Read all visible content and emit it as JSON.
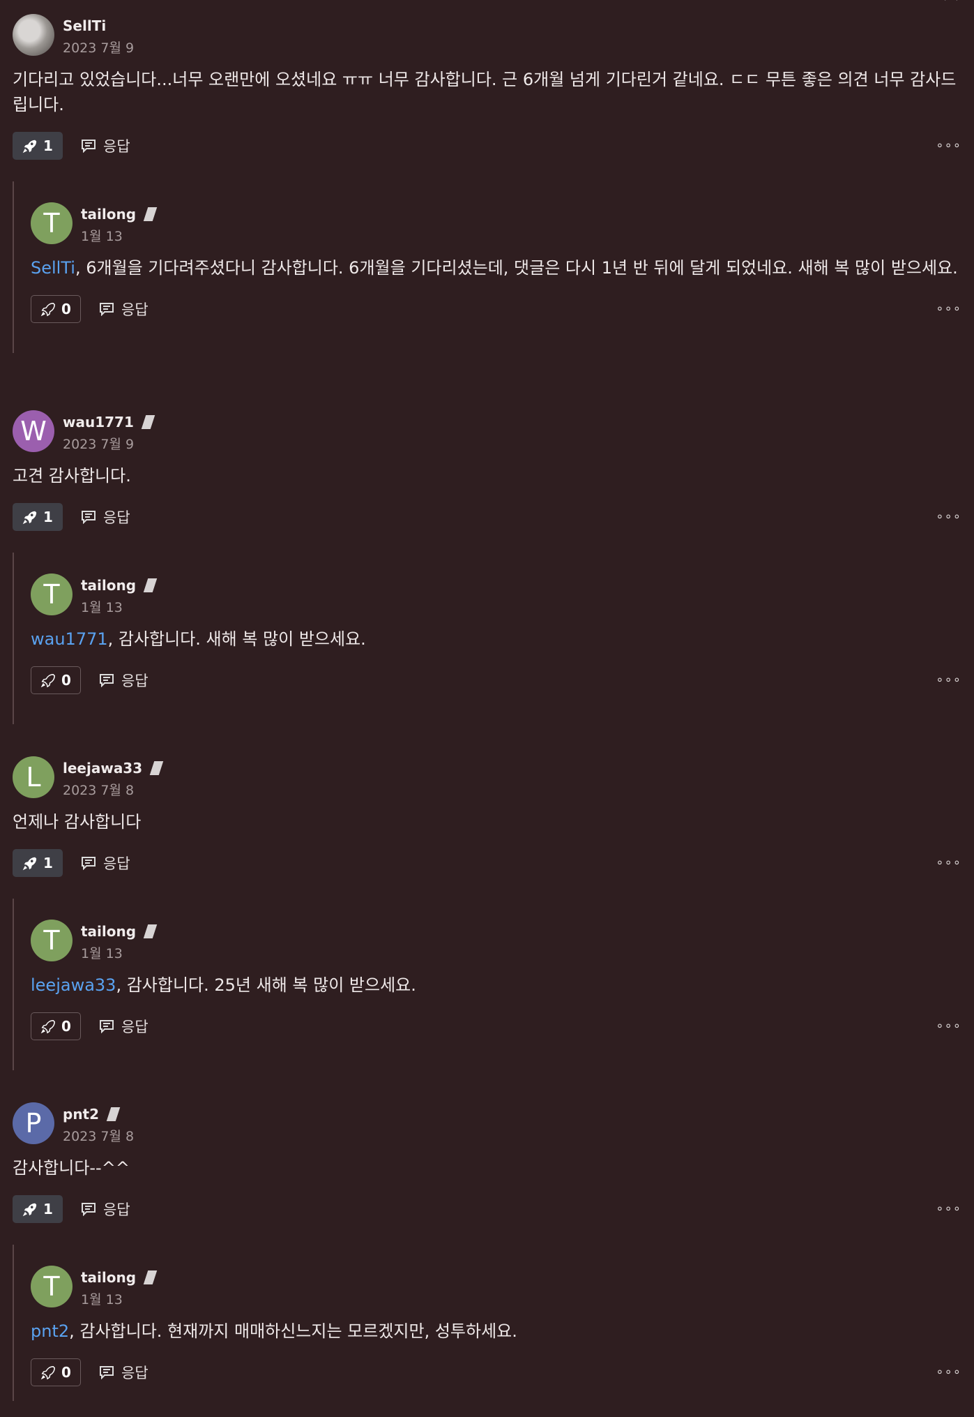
{
  "comments": [
    {
      "user": "SellTi",
      "date": "2023 7월 9",
      "text": "기다리고 있었습니다...너무 오랜만에 오셨네요 ㅠㅠ 너무 감사합니다. 근 6개월 넘게 기다린거 같네요. ㄷㄷ 무튼 좋은 의견 너무 감사드립니다.",
      "likes": "1",
      "reply_label": "응답",
      "more": "∘∘∘",
      "reply": {
        "user": "tailong",
        "date": "1월 13",
        "avatar_letter": "T",
        "mention": "SellTi",
        "text": ", 6개월을 기다려주셨다니 감사합니다. 6개월을 기다리셨는데, 댓글은 다시 1년 반 뒤에 달게 되었네요. 새해 복 많이 받으세요.",
        "likes": "0",
        "reply_label": "응답",
        "more": "∘∘∘"
      }
    },
    {
      "user": "wau1771",
      "date": "2023 7월 9",
      "avatar_letter": "W",
      "text": "고견 감사합니다.",
      "likes": "1",
      "reply_label": "응답",
      "more": "∘∘∘",
      "reply": {
        "user": "tailong",
        "date": "1월 13",
        "avatar_letter": "T",
        "mention": "wau1771",
        "text": ", 감사합니다. 새해 복 많이 받으세요.",
        "likes": "0",
        "reply_label": "응답",
        "more": "∘∘∘"
      }
    },
    {
      "user": "leejawa33",
      "date": "2023 7월 8",
      "avatar_letter": "L",
      "text": "언제나 감사합니다",
      "likes": "1",
      "reply_label": "응답",
      "more": "∘∘∘",
      "reply": {
        "user": "tailong",
        "date": "1월 13",
        "avatar_letter": "T",
        "mention": "leejawa33",
        "text": ", 감사합니다. 25년 새해 복 많이 받으세요.",
        "likes": "0",
        "reply_label": "응답",
        "more": "∘∘∘"
      }
    },
    {
      "user": "pnt2",
      "date": "2023 7월 8",
      "avatar_letter": "P",
      "text": "감사합니다--^^",
      "likes": "1",
      "reply_label": "응답",
      "more": "∘∘∘",
      "reply": {
        "user": "tailong",
        "date": "1월 13",
        "avatar_letter": "T",
        "mention": "pnt2",
        "text": ", 감사합니다. 현재까지 매매하신느지는 모르겠지만, 성투하세요.",
        "likes": "0",
        "reply_label": "응답",
        "more": "∘∘∘"
      }
    }
  ],
  "colors": {
    "background": "#2f1e20",
    "mention": "#5aa2f0",
    "avatar_tailong": "#7fa05e",
    "avatar_wau1771": "#9b5fae",
    "avatar_leejawa33": "#7fa05e",
    "avatar_pnt2": "#5b6aa8"
  },
  "icons": {
    "like": "rocket-icon",
    "reply": "speech-bubble-icon",
    "more": "ellipsis-icon"
  }
}
